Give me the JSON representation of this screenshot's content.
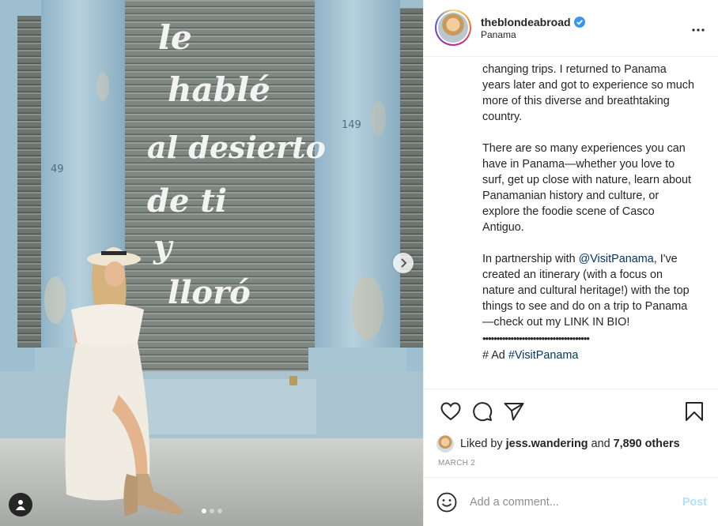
{
  "post": {
    "username": "theblondeabroad",
    "location": "Panama",
    "verified_icon": "verified-badge-icon",
    "more_icon": "more-options-icon"
  },
  "photo": {
    "wall_text": [
      "le",
      "hablé",
      "al desierto",
      "de ti",
      "y",
      "lloró"
    ],
    "wall_numbers": [
      "149",
      "49"
    ],
    "carousel_count": 3,
    "carousel_active": 1
  },
  "caption": {
    "p1": "changing trips. I returned to Panama years later and got to experience so much more of this diverse and breathtaking country.",
    "p2": "There are so many experiences you can have in Panama—whether you love to surf, get up close with nature, learn about Panamanian history and culture, or explore the foodie scene of Casco Antiguo.",
    "p3_before": "In partnership with ",
    "p3_mention": "@VisitPanama",
    "p3_after": ", I've created an itinerary (with a focus on nature and cultural heritage!) with the top things to see and do on a trip to Panama—check out my LINK IN BIO!",
    "bullets": "••••••••••••••••••••••••••••••••••••••",
    "ad_prefix": "# Ad ",
    "ad_hashtag": "#VisitPanama"
  },
  "likes": {
    "prefix": "Liked by ",
    "user": "jess.wandering",
    "middle": " and ",
    "count": "7,890 others"
  },
  "date": "MARCH 2",
  "comment": {
    "placeholder": "Add a comment...",
    "post_label": "Post"
  },
  "colors": {
    "wall_blue": "#9cc0d2",
    "shutter_gray": "#7d8580",
    "link": "#00376b",
    "post_disabled": "#b2dffc"
  }
}
